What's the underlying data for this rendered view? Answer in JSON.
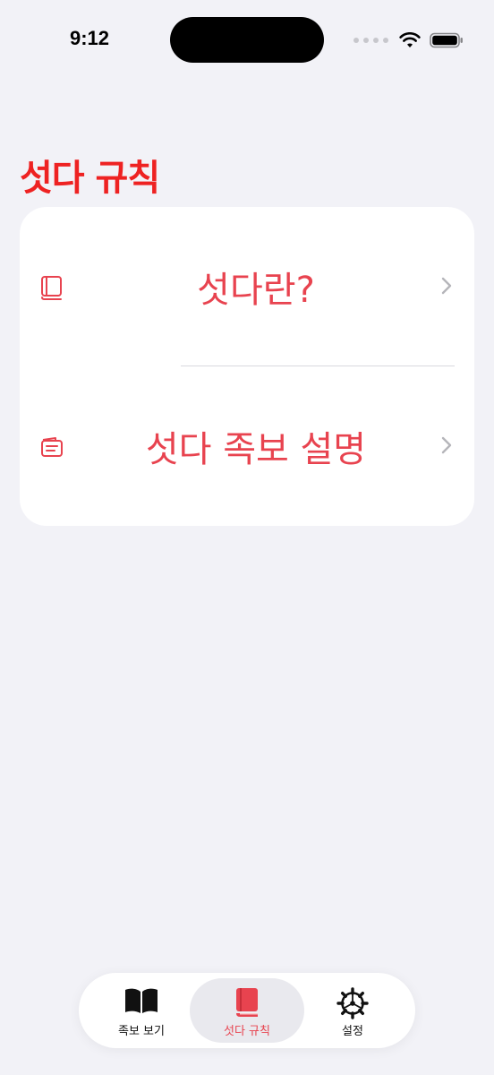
{
  "status_bar": {
    "time": "9:12"
  },
  "title": "섯다 규칙",
  "colors": {
    "accent": "#e8434f",
    "title": "#ee2222",
    "background": "#f2f2f7"
  },
  "list": {
    "items": [
      {
        "label": "섯다란?",
        "icon": "book-icon"
      },
      {
        "label": "섯다 족보 설명",
        "icon": "note-icon"
      }
    ]
  },
  "tabbar": {
    "selected": 1,
    "tabs": [
      {
        "label": "족보 보기",
        "icon": "open-book-icon"
      },
      {
        "label": "섯다 규칙",
        "icon": "closed-book-icon"
      },
      {
        "label": "설정",
        "icon": "gear-icon"
      }
    ]
  }
}
